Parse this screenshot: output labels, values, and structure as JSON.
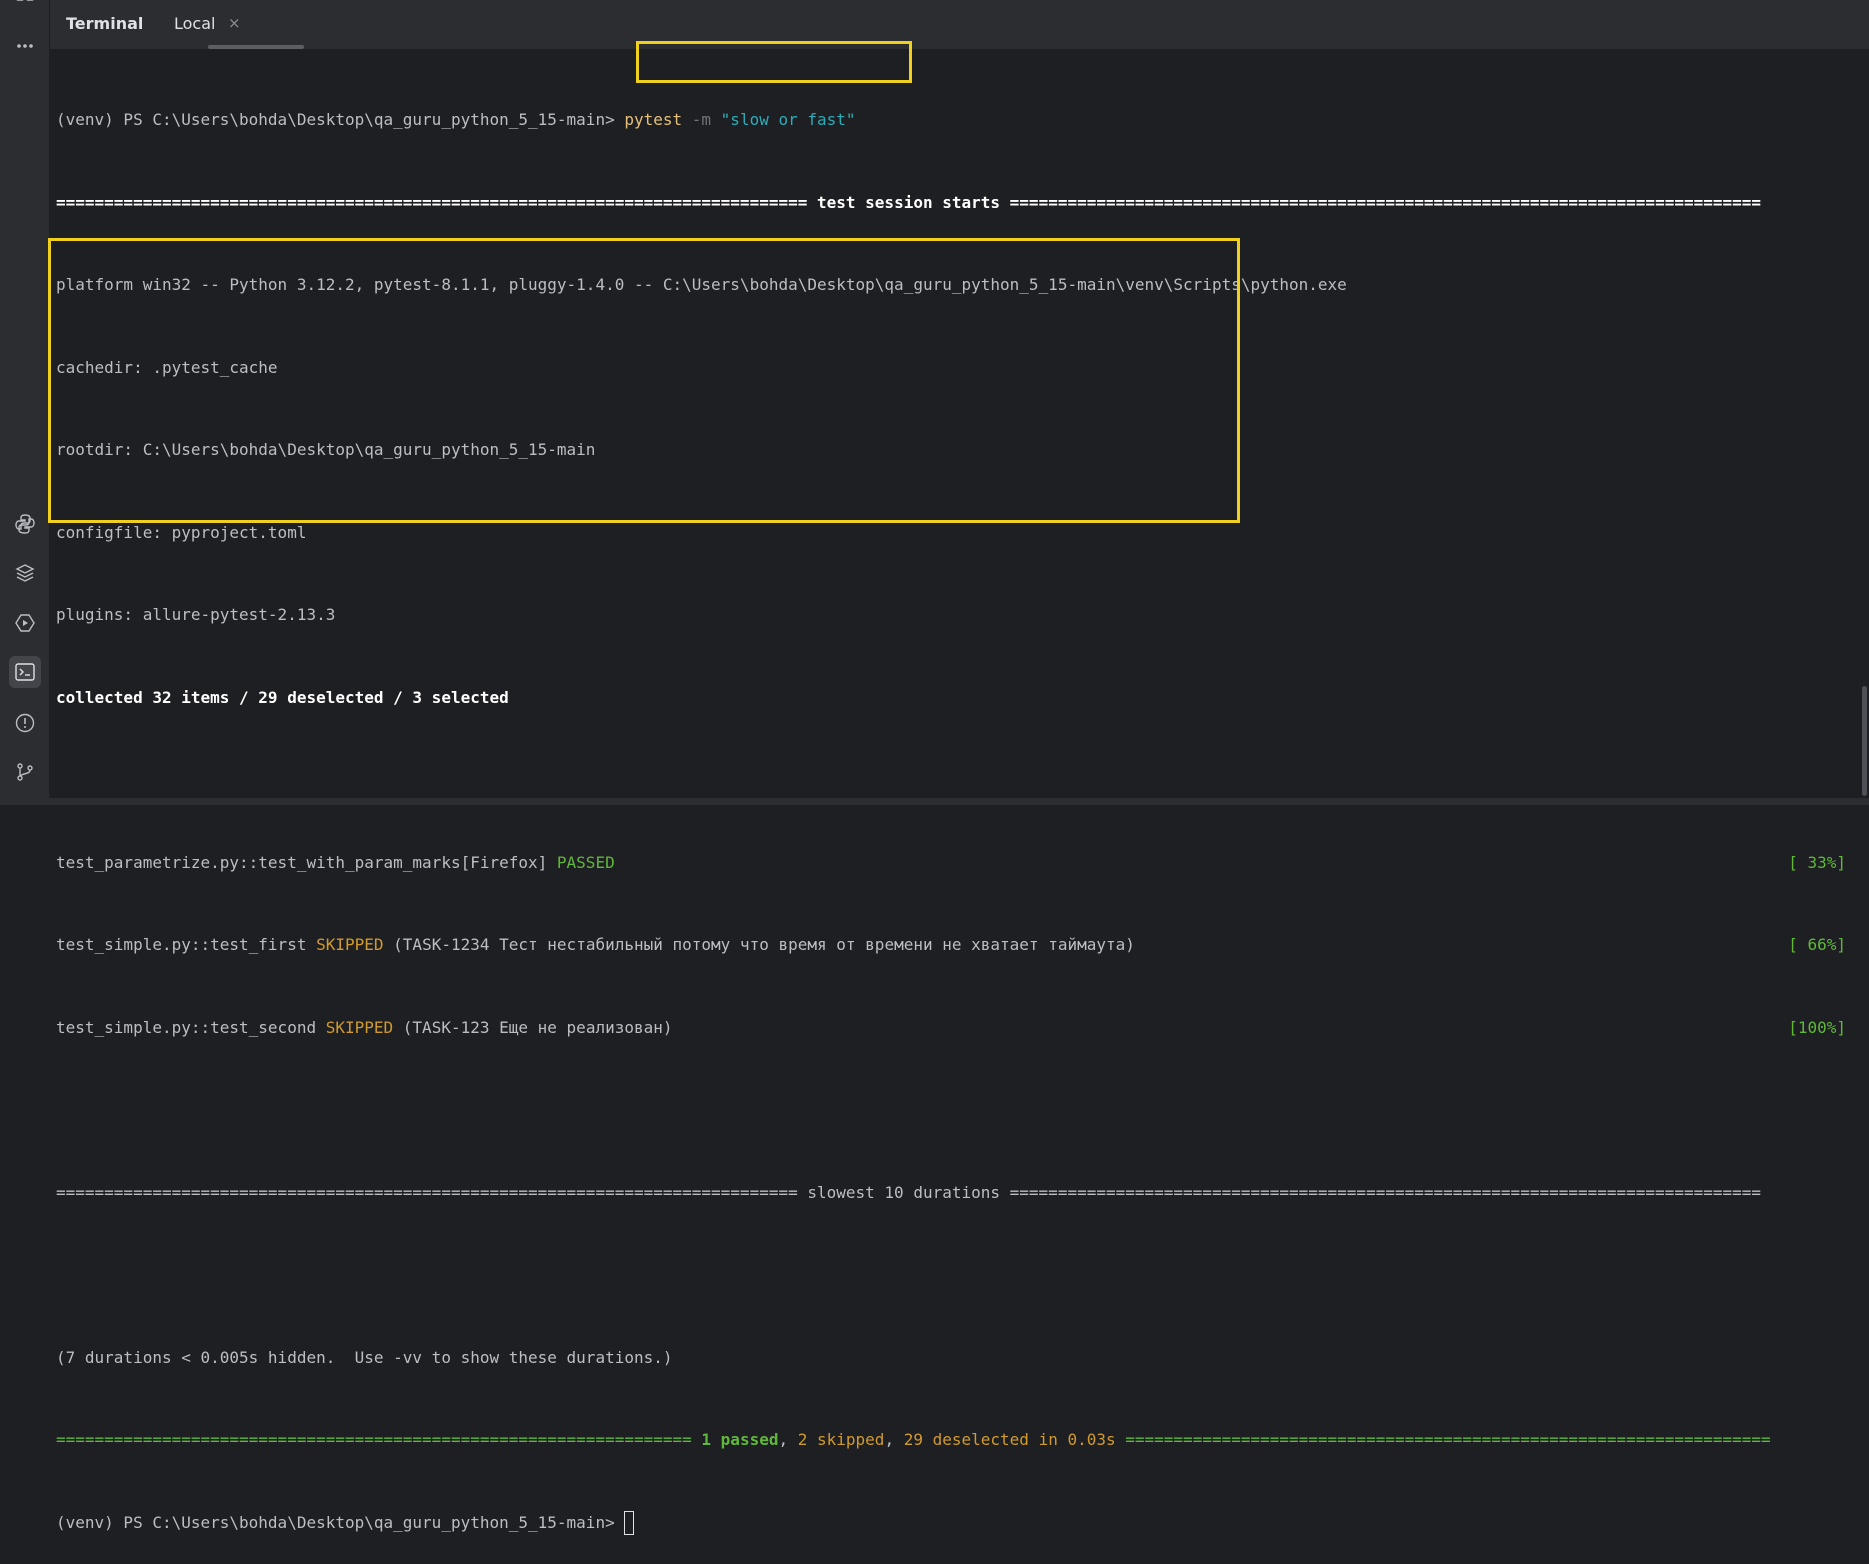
{
  "left_strip": {
    "icons": [
      "grid-icon",
      "more-icon",
      "python-icon",
      "layers-icon",
      "run-icon",
      "terminal-icon",
      "problems-icon",
      "git-icon"
    ]
  },
  "tabs": {
    "terminal": "Terminal",
    "local": "Local",
    "close": "×"
  },
  "terminal": {
    "prompt1": "(venv) PS C:\\Users\\bohda\\Desktop\\qa_guru_python_5_15-main> ",
    "cmd": "pytest",
    "flag": " -m ",
    "arg": "\"slow or fast\"",
    "session_left": "============================================================================== ",
    "session_text": "test session starts",
    "session_right": " ==============================================================================",
    "platform": "platform win32 -- Python 3.12.2, pytest-8.1.1, pluggy-1.4.0 -- C:\\Users\\bohda\\Desktop\\qa_guru_python_5_15-main\\venv\\Scripts\\python.exe",
    "cachedir": "cachedir: .pytest_cache",
    "rootdir": "rootdir: C:\\Users\\bohda\\Desktop\\qa_guru_python_5_15-main",
    "configfile": "configfile: pyproject.toml",
    "plugins": "plugins: allure-pytest-2.13.3",
    "collected": "collected 32 items / 29 deselected / 3 selected",
    "tests": [
      {
        "name": "test_parametrize.py::test_with_param_marks[Firefox] ",
        "status": "PASSED",
        "note": "",
        "pct": "[ 33%]"
      },
      {
        "name": "test_simple.py::test_first ",
        "status": "SKIPPED",
        "note": " (TASK-1234 Тест нестабильный потому что время от времени не хватает таймаута)",
        "pct": "[ 66%]"
      },
      {
        "name": "test_simple.py::test_second ",
        "status": "SKIPPED",
        "note": " (TASK-123 Еще не реализован)",
        "pct": "[100%]"
      }
    ],
    "slowest": "============================================================================= slowest 10 durations ==============================================================================",
    "durations_note": "(7 durations < 0.005s hidden.  Use -vv to show these durations.)",
    "summary_left": "================================================================== ",
    "summary_passed": "1 passed",
    "summary_sep1": ", ",
    "summary_skipped": "2 skipped",
    "summary_sep2": ", ",
    "summary_deselected": "29 deselected in 0.03s",
    "summary_right": " ===================================================================",
    "prompt2": "(venv) PS C:\\Users\\bohda\\Desktop\\qa_guru_python_5_15-main> "
  },
  "colors": {
    "highlight": "#f0d01c",
    "passed": "#5fb83a",
    "skipped": "#d19a2d",
    "string": "#2aacb8",
    "command": "#e5c07b"
  }
}
